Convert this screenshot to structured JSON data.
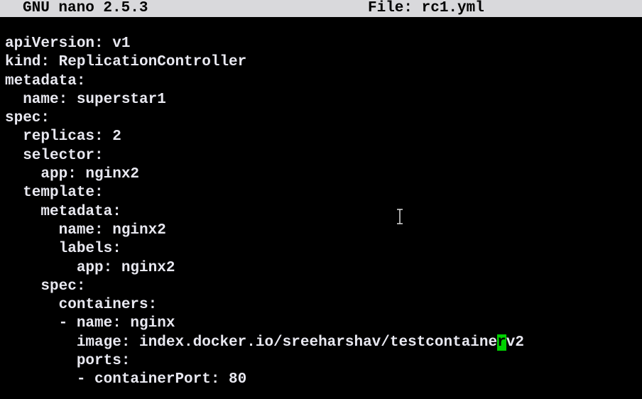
{
  "titlebar": {
    "app_name": "GNU nano 2.5.3",
    "file_label": "File: rc1.yml"
  },
  "editor": {
    "lines": [
      "apiVersion: v1",
      "kind: ReplicationController",
      "metadata:",
      "  name: superstar1",
      "spec:",
      "  replicas: 2",
      "  selector:",
      "    app: nginx2",
      "  template:",
      "    metadata:",
      "      name: nginx2",
      "      labels:",
      "        app: nginx2",
      "    spec:",
      "      containers:",
      "      - name: nginx",
      "        image: index.docker.io/sreeharshav/testcontainer:v2",
      "        ports:",
      "        - containerPort: 80"
    ],
    "cursor": {
      "line_index": 16,
      "before": "        image: index.docker.io/sreeharshav/testcontaine",
      "char": "r",
      "after": "v2"
    }
  },
  "colors": {
    "background": "#000000",
    "text": "#e8e8f0",
    "titlebar_bg": "#d9d9dc",
    "cursor": "#00d000"
  },
  "icons": {
    "mouse_pointer": "text-ibeam-icon"
  }
}
